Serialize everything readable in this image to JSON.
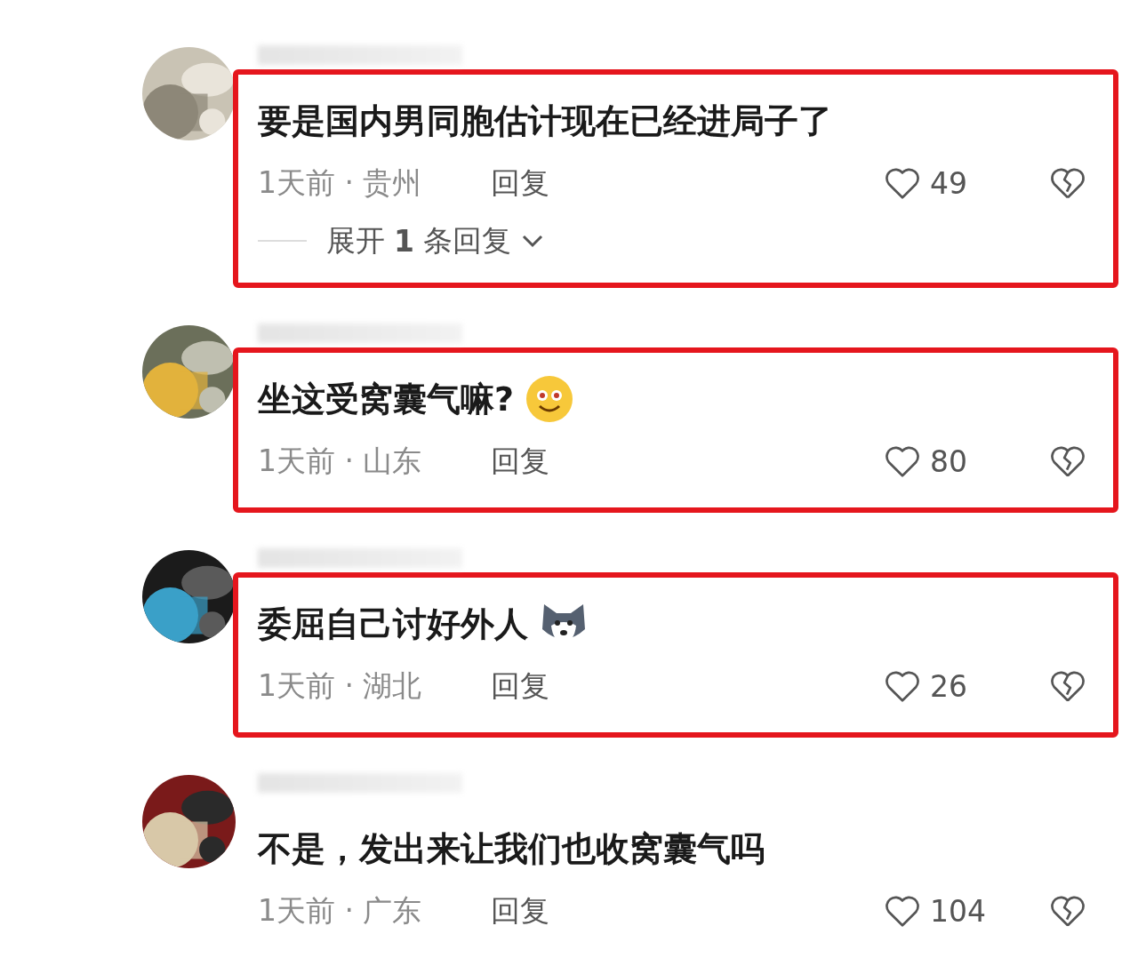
{
  "comments": [
    {
      "text": "要是国内男同胞估计现在已经进局子了",
      "kind": "plain",
      "meta": "1天前 · 贵州",
      "reply": "回复",
      "likes": "49",
      "expand": "展开**1**条回复",
      "highlighted": true
    },
    {
      "text": "坐这受窝囊气嘛?",
      "kind": "smiley",
      "meta": "1天前 · 山东",
      "reply": "回复",
      "likes": "80",
      "highlighted": true
    },
    {
      "text": "委屈自己讨好外人",
      "kind": "husky",
      "meta": "1天前 · 湖北",
      "reply": "回复",
      "likes": "26",
      "highlighted": true
    },
    {
      "text": "不是，发出来让我们也收窝囊气吗",
      "kind": "plain",
      "meta": "1天前 · 广东",
      "reply": "回复",
      "likes": "104",
      "highlighted": false
    }
  ]
}
